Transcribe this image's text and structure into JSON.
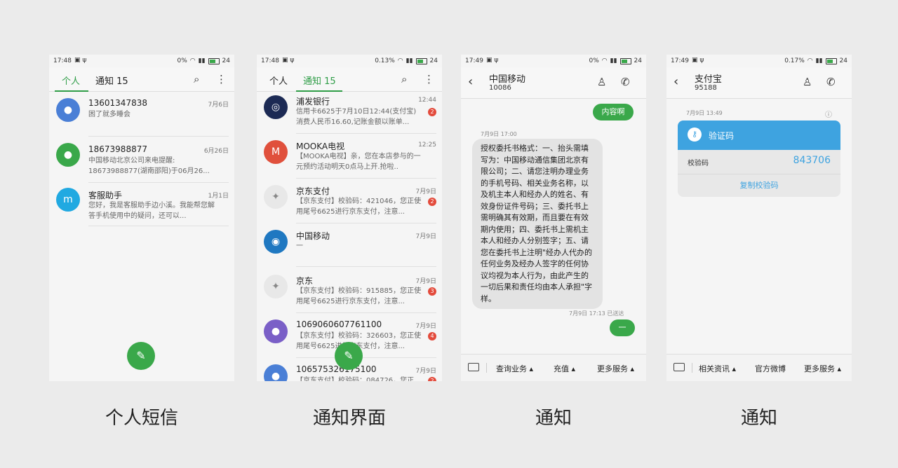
{
  "screens": [
    {
      "caption": "个人短信",
      "status": {
        "time": "17:48",
        "speed": "0%",
        "battery": "24"
      },
      "tabs": [
        "个人",
        "通知 15"
      ],
      "items": [
        {
          "name": "13601347838",
          "date": "7月6日",
          "preview": "困了就多睡会"
        },
        {
          "name": "18673988877",
          "date": "6月26日",
          "preview": "中国移动北京公司来电提醒: 18673988877(湖南邵阳)于06月26..."
        },
        {
          "name": "客服助手",
          "date": "1月1日",
          "preview": "您好，我是客服助手边小溪。我能帮您解答手机使用中的疑问，还可以..."
        }
      ]
    },
    {
      "caption": "通知界面",
      "status": {
        "time": "17:48",
        "speed": "0.13%",
        "battery": "24"
      },
      "tabs": [
        "个人",
        "通知 15"
      ],
      "items": [
        {
          "name": "浦发银行",
          "date": "12:44",
          "preview": "信用卡6625于7月10日12:44(支付宝)消费人民币16.60,记账金额以账单...",
          "badge": "2"
        },
        {
          "name": "MOOKA电视",
          "date": "12:25",
          "preview": "【MOOKA电视】亲，您在本店参与的一元预约活动明天0点马上开.抢啦..",
          "avatar": "M"
        },
        {
          "name": "京东支付",
          "date": "7月9日",
          "preview": "【京东支付】校验码：421046，您正使用尾号6625进行京东支付，注意...",
          "badge": "2"
        },
        {
          "name": "中国移动",
          "date": "7月9日",
          "preview": "一"
        },
        {
          "name": "京东",
          "date": "7月9日",
          "preview": "【京东支付】校验码：915885，您正使用尾号6625进行京东支付，注意...",
          "badge": "3"
        },
        {
          "name": "1069060607761100",
          "date": "7月9日",
          "preview": "【京东支付】校验码：326603，您正使用尾号6625进行京东支付，注意...",
          "badge": "4"
        },
        {
          "name": "10657532617​5100",
          "date": "7月9日",
          "preview": "【京东支付】校验码：084726，您正",
          "badge": "2"
        }
      ]
    },
    {
      "caption": "通知",
      "status": {
        "time": "17:49",
        "speed": "0%",
        "battery": "24"
      },
      "title": "中国移动",
      "number": "10086",
      "messages": {
        "out1": "内容啊",
        "in_meta": "7月9日 17:00",
        "in_text": "授权委托书格式：一、抬头需填写为：中国移动通信集团北京有限公司；二、请您注明办理业务的手机号码、相关业务名称，以及机主本人和经办人的姓名、有效身份证件号码；三、委托书上需明确其有效期，而且要在有效期内使用；四、委托书上需机主本人和经办人分别签字；五、请您在委托书上注明\"经办人代办的任何业务及经办人签字的任何协议均视为本人行为，由此产生的一切后果和责任均由本人承担\"字样。",
        "out_meta_time": "7月9日 17:13",
        "out_meta_status": "已送达",
        "out2": "一"
      },
      "bottom": [
        "查询业务",
        "充值",
        "更多服务"
      ]
    },
    {
      "caption": "通知",
      "status": {
        "time": "17:49",
        "speed": "0.17%",
        "battery": "24"
      },
      "title": "支付宝",
      "number": "95188",
      "message_meta": "7月9日 13:49",
      "card": {
        "title": "验证码",
        "label": "校验码",
        "code": "843706",
        "link": "复制校验码"
      },
      "bottom": [
        "相关资讯",
        "官方微博",
        "更多服务"
      ]
    }
  ],
  "colors": {
    "accent_green": "#3aa84a",
    "alipay_blue": "#3ea3e0",
    "badge_red": "#e34b3c"
  }
}
